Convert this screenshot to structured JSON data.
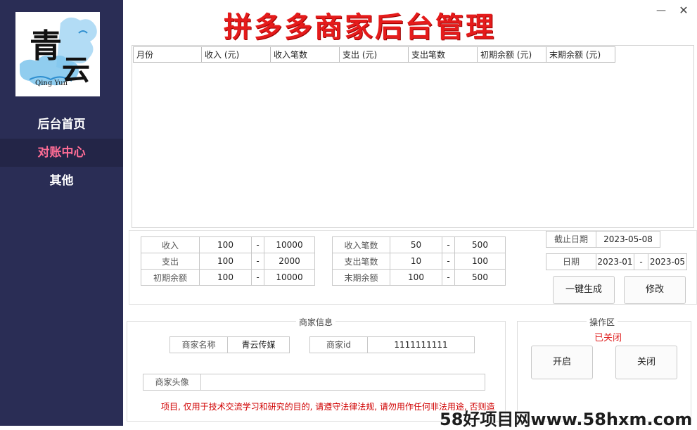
{
  "app": {
    "title": "拼多多商家后台管理"
  },
  "logo": {
    "main_chars_1": "青",
    "main_chars_2": "云",
    "caption": "Qing Yun"
  },
  "window": {
    "minimize": "—",
    "close": "✕"
  },
  "sidebar": {
    "items": [
      {
        "label": "后台首页"
      },
      {
        "label": "对账中心"
      },
      {
        "label": "其他"
      }
    ],
    "active_index": 1
  },
  "grid": {
    "columns": [
      "月份",
      "收入 (元)",
      "收入笔数",
      "支出 (元)",
      "支出笔数",
      "初期余额 (元)",
      "末期余额 (元)"
    ],
    "rows": []
  },
  "params": {
    "left": [
      {
        "label": "收入",
        "min": "100",
        "sep": "-",
        "max": "10000"
      },
      {
        "label": "支出",
        "min": "100",
        "sep": "-",
        "max": "2000"
      },
      {
        "label": "初期余额",
        "min": "100",
        "sep": "-",
        "max": "10000"
      }
    ],
    "right": [
      {
        "label": "收入笔数",
        "min": "50",
        "sep": "-",
        "max": "500"
      },
      {
        "label": "支出笔数",
        "min": "10",
        "sep": "-",
        "max": "100"
      },
      {
        "label": "末期余额",
        "min": "100",
        "sep": "-",
        "max": "500"
      }
    ],
    "cutoff": {
      "label": "截止日期",
      "value": "2023-05-08"
    },
    "date_range": {
      "label": "日期",
      "start": "2023-01",
      "sep": "-",
      "end": "2023-05"
    },
    "generate_button": "一键生成",
    "modify_button": "修改"
  },
  "merchant": {
    "group_title": "商家信息",
    "name_label": "商家名称",
    "name_value": "青云传媒",
    "id_label": "商家id",
    "id_value": "1111111111",
    "avatar_label": "商家头像",
    "avatar_value": ""
  },
  "ops": {
    "group_title": "操作区",
    "status": "已关闭",
    "open_button": "开启",
    "close_button": "关闭"
  },
  "disclaimer": "项目, 仅用于技术交流学习和研究的目的, 请遵守法律法规, 请勿用作任何非法用途, 否则造成",
  "watermark": "58好项目网www.58hxm.com",
  "colors": {
    "sidebar": "#2a2d55",
    "active_nav": "#ff6d96",
    "title": "#e51b1b",
    "status": "#e02020"
  }
}
